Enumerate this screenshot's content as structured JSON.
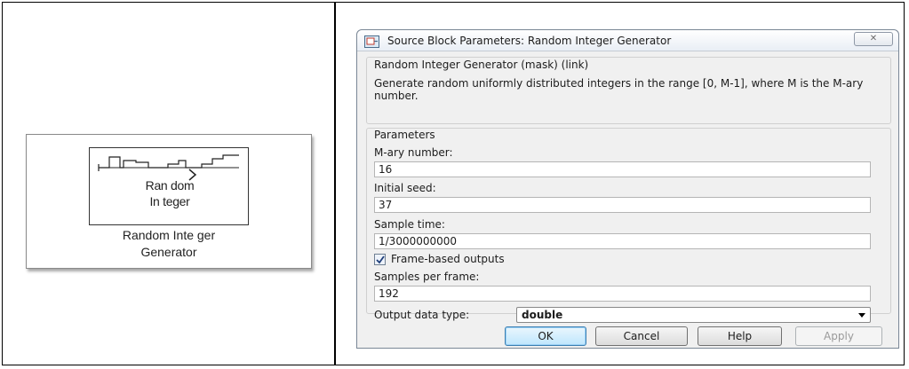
{
  "block": {
    "label_line1": "Ran dom",
    "label_line2": "In teger",
    "name_line1": "Random Inte ger",
    "name_line2": "Generator"
  },
  "dialog": {
    "title": "Source Block Parameters: Random Integer Generator",
    "close_glyph": "✕",
    "mask_title": "Random Integer Generator (mask) (link)",
    "mask_description": "Generate random uniformly distributed integers in the range [0, M-1], where M is the M-ary number.",
    "parameters_title": "Parameters",
    "fields": {
      "mary": {
        "label": "M-ary number:",
        "value": "16"
      },
      "seed": {
        "label": "Initial seed:",
        "value": "37"
      },
      "sample_time": {
        "label": "Sample time:",
        "value": "1/3000000000"
      },
      "frame_based": {
        "label": "Frame-based outputs",
        "checked": true
      },
      "samples_per_frame": {
        "label": "Samples per frame:",
        "value": "192"
      },
      "output_type": {
        "label": "Output data type:",
        "value": "double"
      }
    },
    "buttons": {
      "ok": "OK",
      "cancel": "Cancel",
      "help": "Help",
      "apply": "Apply"
    }
  },
  "icons": {
    "title_icon": "simulink-block-icon",
    "close": "close-icon",
    "check": "checkmark-icon",
    "dropdown": "chevron-down-icon"
  }
}
